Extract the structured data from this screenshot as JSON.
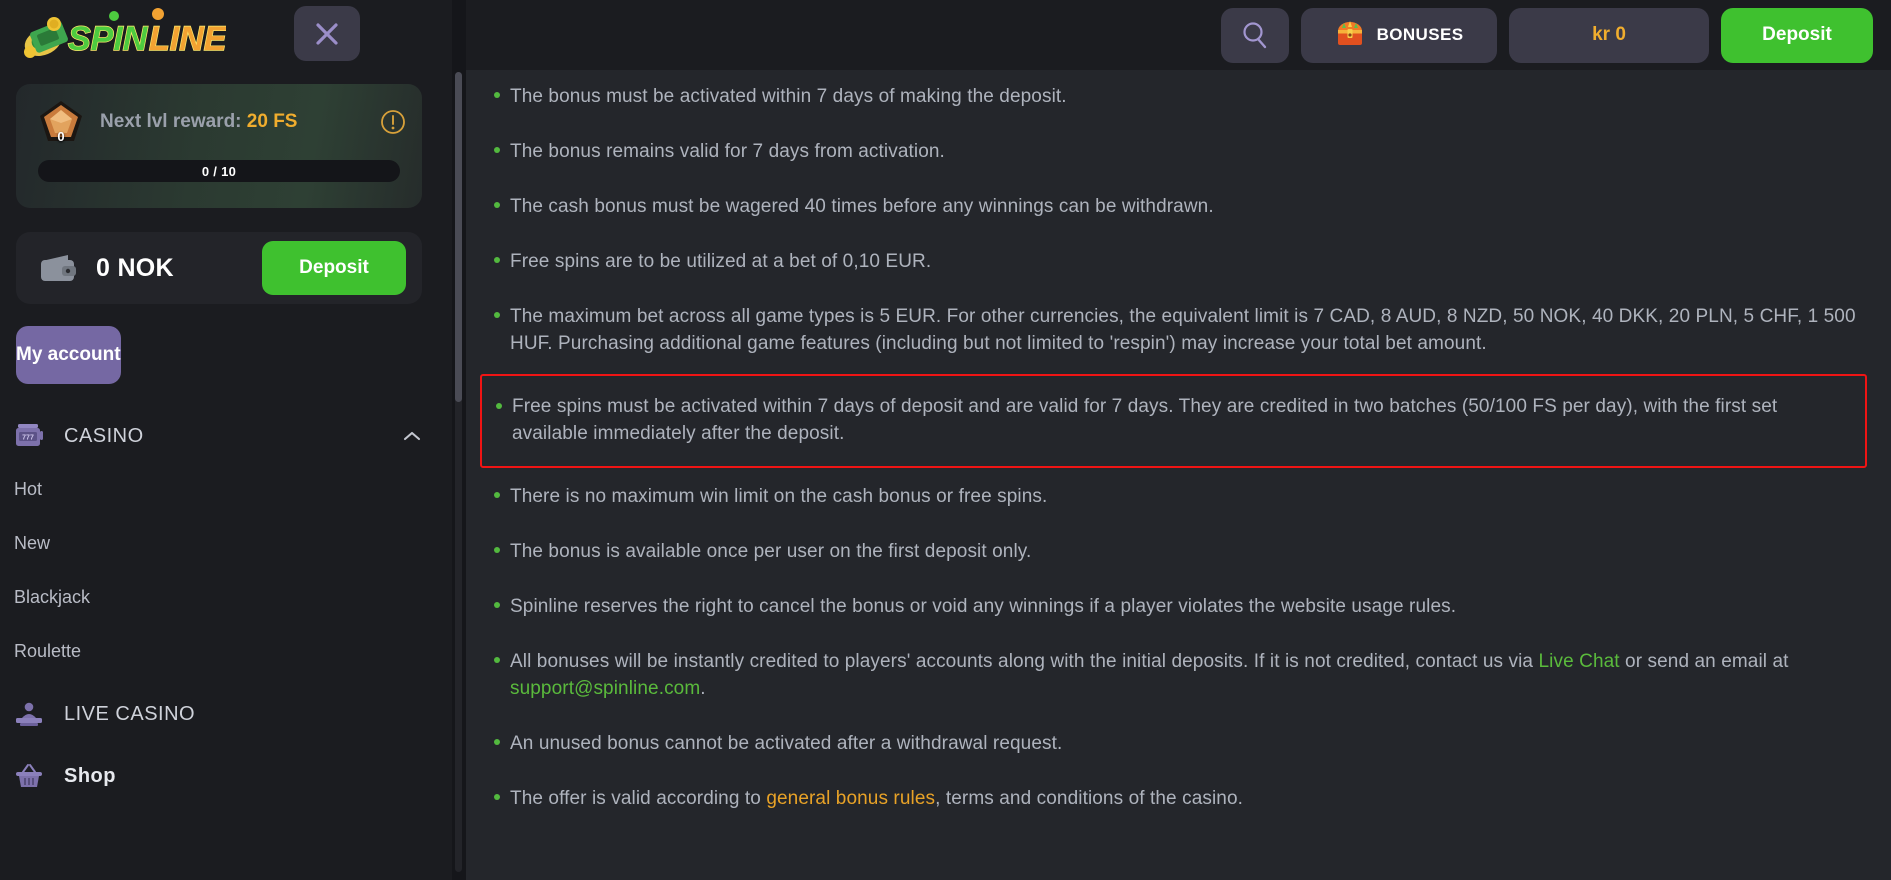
{
  "brand": {
    "name_part1": "SPIN",
    "name_part2": "LINE"
  },
  "sidebar": {
    "close_label": "close-icon",
    "level_card": {
      "level_number": "0",
      "reward_prefix": "Next lvl reward: ",
      "reward_value": "20 FS",
      "progress_text": "0 / 10",
      "progress_current": 0,
      "progress_max": 10
    },
    "wallet": {
      "balance": "0 NOK",
      "deposit_label": "Deposit"
    },
    "account_button": "My account",
    "nav": [
      {
        "label": "CASINO",
        "icon": "slot-machine-icon",
        "expanded": true,
        "children": [
          "Hot",
          "New",
          "Blackjack",
          "Roulette"
        ]
      },
      {
        "label": "LIVE CASINO",
        "icon": "live-dealer-icon",
        "expanded": false,
        "children": []
      },
      {
        "label": "Shop",
        "icon": "basket-icon",
        "expanded": false,
        "children": []
      }
    ]
  },
  "topbar": {
    "search_label": "search-icon",
    "bonuses_label": "BONUSES",
    "balance_label": "kr 0",
    "deposit_label": "Deposit"
  },
  "content": {
    "terms": [
      {
        "text": "The bonus must be activated within 7 days of making the deposit.",
        "highlight": false
      },
      {
        "text": "The bonus remains valid for 7 days from activation.",
        "highlight": false
      },
      {
        "text": "The cash bonus must be wagered 40 times before any winnings can be withdrawn.",
        "highlight": false
      },
      {
        "text": "Free spins are to be utilized at a bet of 0,10 EUR.",
        "highlight": false
      },
      {
        "text": "The maximum bet across all game types is 5 EUR. For other currencies, the equivalent limit is 7 CAD, 8 AUD, 8 NZD, 50 NOK, 40 DKK, 20 PLN, 5 CHF, 1 500 HUF. Purchasing additional game features (including but not limited to 'respin') may increase your total bet amount.",
        "highlight": false
      },
      {
        "text": "Free spins must be activated within 7 days of deposit and are valid for 7 days. They are credited in two batches (50/100 FS per day), with the first set available immediately after the deposit.",
        "highlight": true
      },
      {
        "text": "There is no maximum win limit on the cash bonus or free spins.",
        "highlight": false
      },
      {
        "text": "The bonus is available once per user on the first deposit only.",
        "highlight": false
      },
      {
        "text": "Spinline reserves the right to cancel the bonus or void any winnings if a player violates the website usage rules.",
        "highlight": false
      },
      {
        "text": "All bonuses will be instantly credited to players' accounts along with the initial deposits. If it is not credited, contact us via Live Chat or send an email at support@spinline.com.",
        "highlight": false,
        "links": [
          {
            "text": "Live Chat",
            "color": "green"
          },
          {
            "text": "support@spinline.com",
            "color": "green"
          }
        ]
      },
      {
        "text": "An unused bonus cannot be activated after a withdrawal request.",
        "highlight": false
      },
      {
        "text": "The offer is valid according to general bonus rules, terms and conditions of the casino.",
        "highlight": false,
        "links": [
          {
            "text": "general bonus rules",
            "color": "gold"
          }
        ]
      }
    ]
  },
  "colors": {
    "accent_green": "#3fc12f",
    "accent_purple": "#7568a3",
    "accent_gold": "#f0ad2e",
    "highlight_red": "#f01414",
    "bullet_green": "#53b93f",
    "sidebar_bg": "#1b1c20",
    "main_bg": "#24262b"
  }
}
